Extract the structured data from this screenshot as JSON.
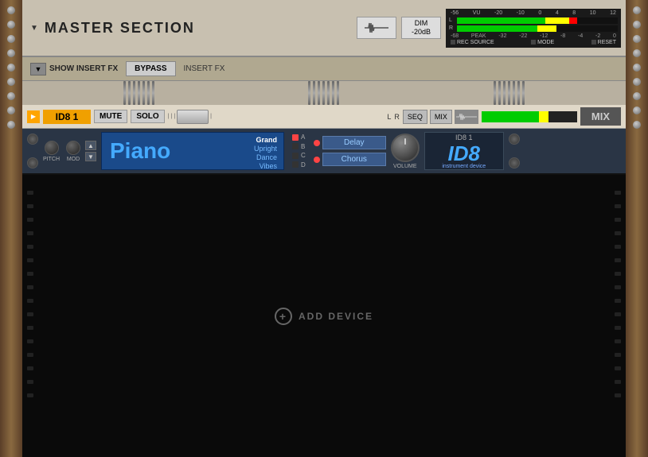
{
  "masterSection": {
    "title": "MASTER SECTION",
    "waveformBtn": "~",
    "dimLabel": "DIM",
    "dimValue": "-20dB",
    "vuScale": [
      "-56",
      "VU",
      "-20",
      "-10",
      "0",
      "4",
      "8",
      "10",
      "12"
    ],
    "leftLabel": "L",
    "rightLabel": "R",
    "peakLabels": [
      "-68",
      "PEAK",
      "-32",
      "-22",
      "-12",
      "-8",
      "-4",
      "-2",
      "0"
    ],
    "recSourceLabel": "REC SOURCE",
    "modeLabel": "MODE",
    "resetLabel": "RESET"
  },
  "insertFx": {
    "showLabel": "SHOW INSERT FX",
    "bypassLabel": "BYPASS",
    "insertFxLabel": "INSERT FX"
  },
  "track": {
    "name": "ID8 1",
    "muteLabel": "MUTE",
    "soloLabel": "SOLO",
    "lLabel": "L",
    "rLabel": "R",
    "seqLabel": "SEQ",
    "mixLabel": "MIX",
    "mixBtnLabel": "MIX"
  },
  "id8": {
    "pitchLabel": "PITCH",
    "modLabel": "MOD",
    "instrumentName": "Piano",
    "presets": [
      "Grand",
      "Upright",
      "Dance",
      "Vibes"
    ],
    "selectedPreset": "Grand",
    "channels": [
      "A",
      "B",
      "C",
      "D"
    ],
    "delayLabel": "Delay",
    "chorusLabel": "Chorus",
    "volumeLabel": "VOLUME",
    "deviceLabel": "ID8 1",
    "logoText": "ID8",
    "instrumentDevice": "instrument device"
  },
  "addDevice": {
    "label": "ADD DEVICE"
  },
  "colors": {
    "orange": "#f0a000",
    "blue": "#1a4a8a",
    "darkBg": "#0a0a0a",
    "accent": "#44aaff"
  }
}
